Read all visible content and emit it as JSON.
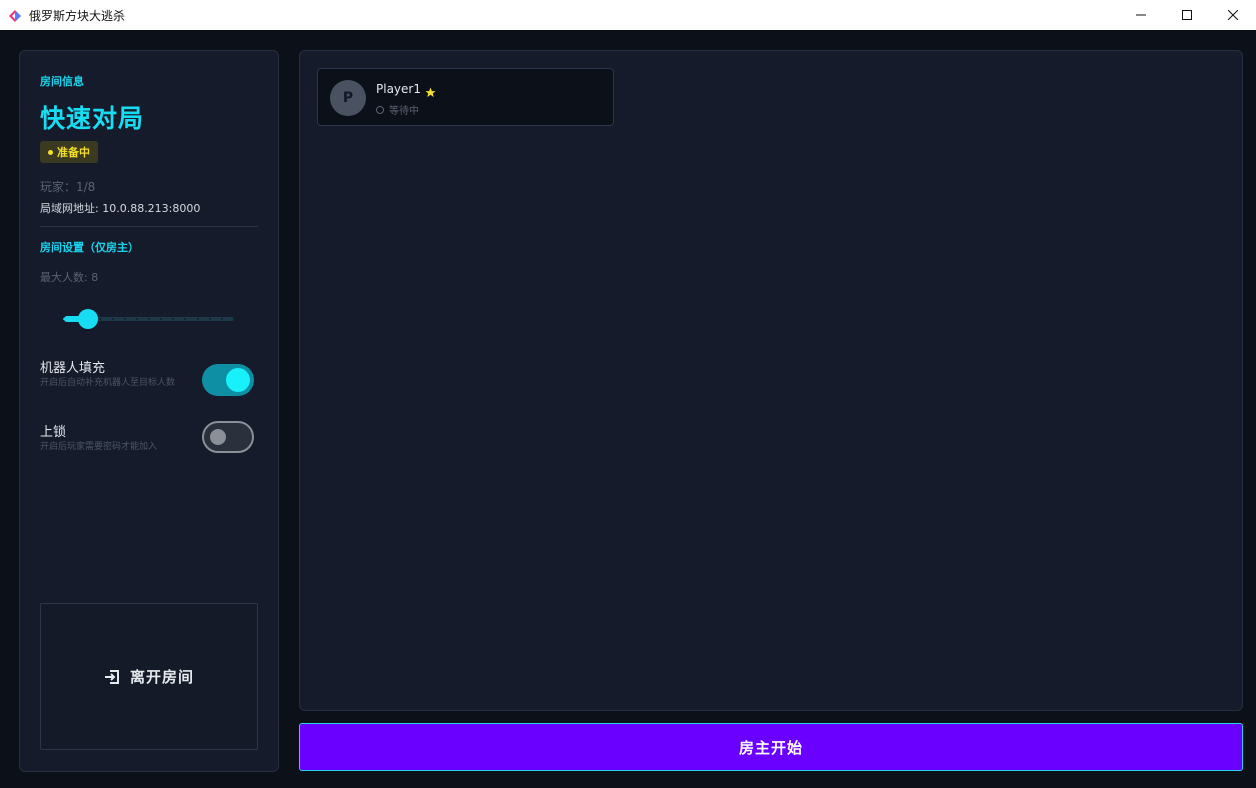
{
  "window": {
    "title": "俄罗斯方块大逃杀"
  },
  "sidebar": {
    "room_info_label": "房间信息",
    "room_name": "快速对局",
    "status": "准备中",
    "players": "玩家：1/8",
    "lan_address": "局域网地址: 10.0.88.213:8000",
    "settings_label": "房间设置（仅房主）",
    "max_players_label": "最大人数: 8",
    "max_players_slider": {
      "value": 8,
      "min": 4,
      "max": 32,
      "step": 2
    },
    "bot_fill": {
      "title": "机器人填充",
      "description": "开启后自动补充机器人至目标人数",
      "enabled": true
    },
    "lock": {
      "title": "上锁",
      "description": "开启后玩家需要密码才能加入",
      "enabled": false
    },
    "leave_button_label": "离开房间"
  },
  "players": [
    {
      "initial": "P",
      "name": "Player1",
      "is_host": true,
      "status": "等待中"
    }
  ],
  "start_button_label": "房主开始",
  "colors": {
    "accent": "#18dcf2",
    "start_button": "#6a00ff",
    "status_badge_text": "#f4de2b",
    "host_star": "#f4de2b"
  },
  "icons": {
    "app": "tetris-logo-icon",
    "leave": "exit-door-icon",
    "host": "star-icon",
    "player_status": "circle-icon"
  }
}
